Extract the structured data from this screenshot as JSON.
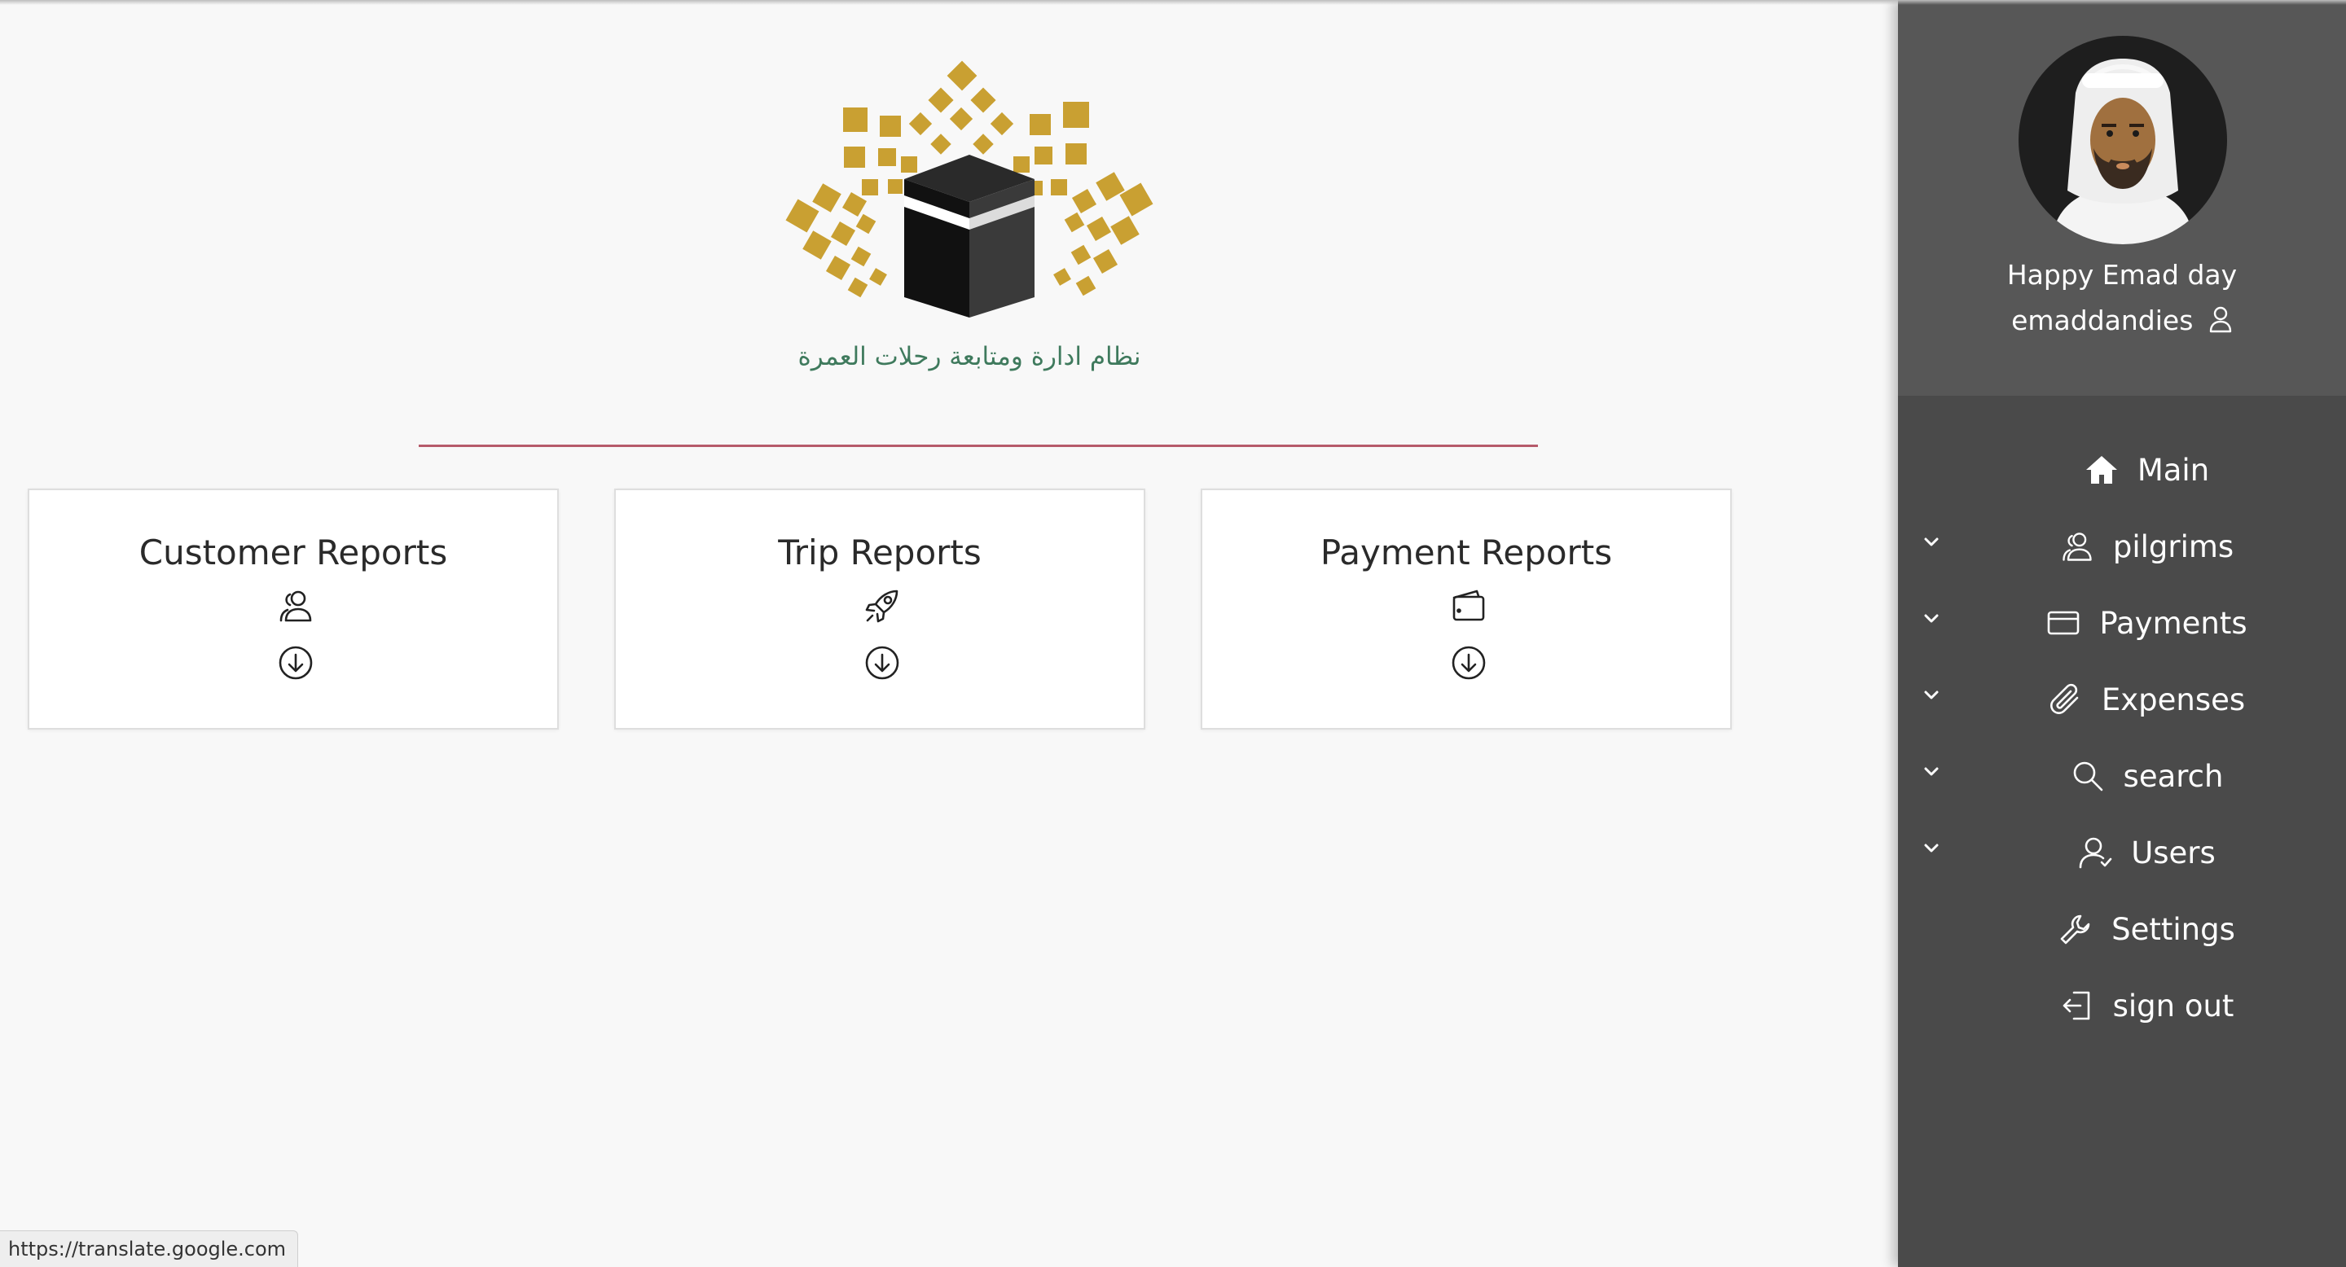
{
  "header": {
    "logo_caption": "نظام ادارة ومتابعة رحلات العمرة"
  },
  "colors": {
    "gold": "#c9a032",
    "kaaba": "#1f1f1f",
    "caption_green": "#3f7a5d",
    "divider": "#b65b6b",
    "sidebar_bg": "#4a4a4a",
    "profile_bg": "#575757"
  },
  "cards": [
    {
      "title": "Customer Reports",
      "icon": "users-icon",
      "action_icon": "download-circle-icon"
    },
    {
      "title": "Trip Reports",
      "icon": "rocket-icon",
      "action_icon": "download-circle-icon"
    },
    {
      "title": "Payment Reports",
      "icon": "wallet-icon",
      "action_icon": "download-circle-icon"
    }
  ],
  "sidebar": {
    "greeting": "Happy Emad day",
    "username": "emaddandies",
    "items": [
      {
        "label": "Main",
        "icon": "home-icon",
        "has_submenu": false
      },
      {
        "label": "pilgrims",
        "icon": "users-icon",
        "has_submenu": true
      },
      {
        "label": "Payments",
        "icon": "credit-card-icon",
        "has_submenu": true
      },
      {
        "label": "Expenses",
        "icon": "paperclip-icon",
        "has_submenu": true
      },
      {
        "label": "search",
        "icon": "search-icon",
        "has_submenu": true
      },
      {
        "label": "Users",
        "icon": "user-icon",
        "has_submenu": true
      },
      {
        "label": "Settings",
        "icon": "wrench-icon",
        "has_submenu": false
      },
      {
        "label": "sign out",
        "icon": "sign-out-icon",
        "has_submenu": false
      }
    ]
  },
  "status_bar": {
    "url": "https://translate.google.com"
  }
}
